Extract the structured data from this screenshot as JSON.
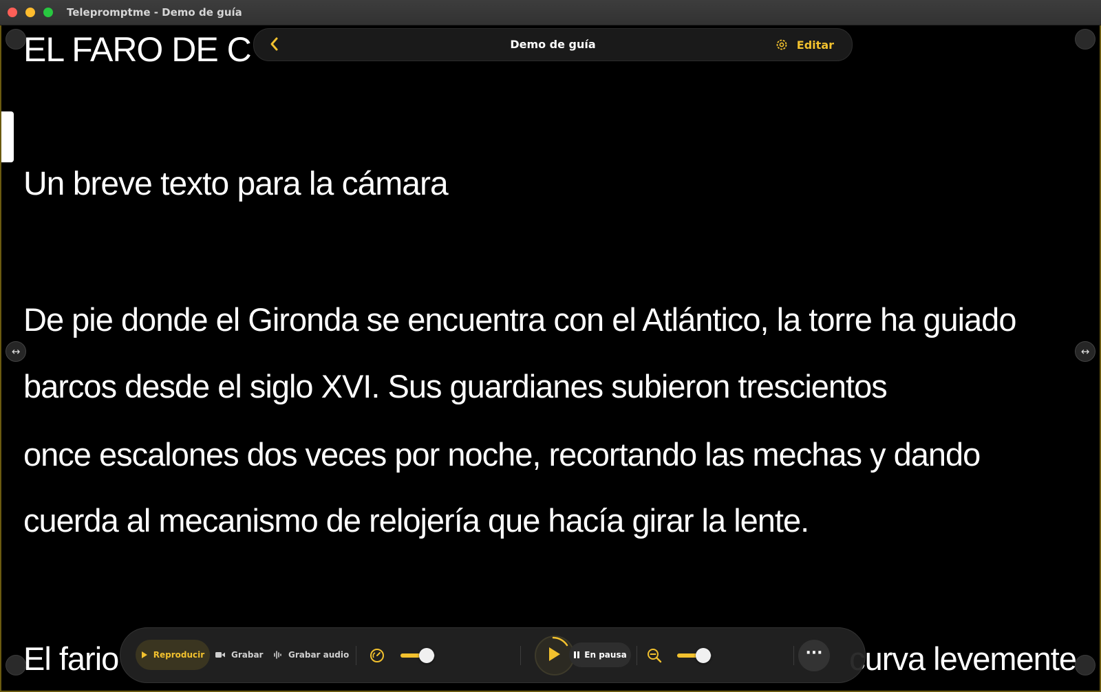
{
  "window": {
    "title": "Telepromptme - Demo de guía"
  },
  "topbar": {
    "title": "Demo de guía",
    "edit_label": "Editar"
  },
  "script": {
    "heading": "EL FARO DE C",
    "subtitle": "Un breve texto para la cámara",
    "lines": [
      "De pie donde el Gironda se encuentra con el Atlántico, la torre ha guiado",
      "barcos desde el siglo XVI. Sus guardianes subieron trescientos",
      "once escalones dos veces por noche, recortando las mechas y dando",
      "cuerda al mecanismo de relojería que hacía girar la lente."
    ],
    "partial_line_start": "El fario",
    "partial_line_end": "curva levemente"
  },
  "toolbar": {
    "play_mode_label": "Reproducir",
    "record_label": "Grabar",
    "record_audio_label": "Grabar audio",
    "speed_level": 0.75,
    "status_label": "En pausa",
    "zoom_level": 0.75
  },
  "colors": {
    "accent": "#f2c12e",
    "background": "#000000",
    "text": "#ffffff"
  },
  "icons": {
    "back": "chevron-left-icon",
    "settings": "gear-icon",
    "play": "play-icon",
    "record": "video-camera-icon",
    "record_audio": "waveform-icon",
    "speed": "speedometer-icon",
    "pause": "pause-icon",
    "zoom": "zoom-out-icon",
    "more": "ellipsis-icon",
    "resize": "horizontal-resize-icon"
  }
}
